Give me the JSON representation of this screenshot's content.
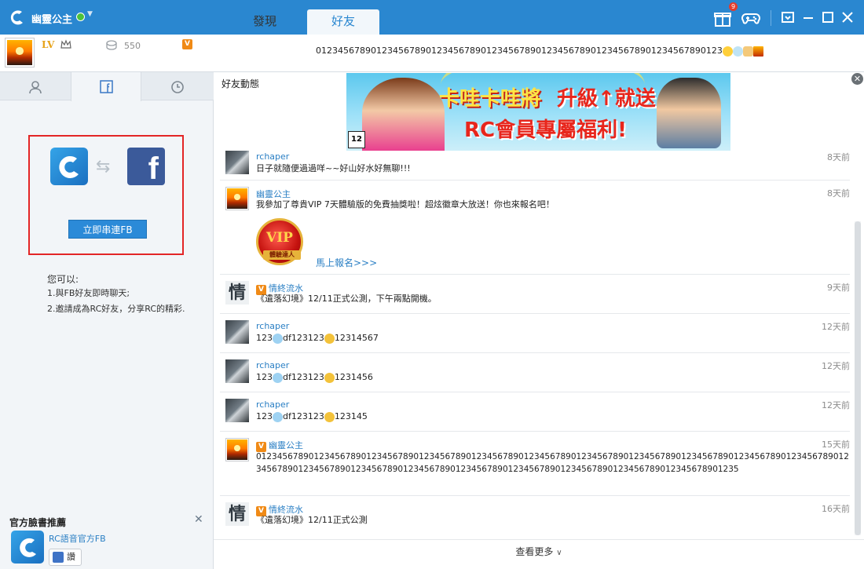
{
  "titlebar": {
    "username": "幽靈公主",
    "tabs": [
      {
        "label": "發現",
        "active": false
      },
      {
        "label": "好友",
        "active": true
      }
    ],
    "gift_badge": "9",
    "accent_color": "#2a87d0"
  },
  "profile": {
    "level_label": "LV",
    "coins": "550",
    "vip_mark": "V",
    "signature": "01234567890123456789012345678901234567890123456789012345678901234567890123"
  },
  "sidebar": {
    "fb_connect_button": "立即串連FB",
    "can_title": "您可以:",
    "can_items": [
      "1.與FB好友即時聊天;",
      "2.邀請成為RC好友，分享RC的精彩."
    ],
    "official_title": "官方臉書推薦",
    "official_name": "RC語音官方FB",
    "like_label": "讚"
  },
  "main": {
    "feed_title": "好友動態",
    "banner": {
      "age": "12",
      "line1a": "卡哇卡哇將",
      "line1b": "升級↑就送",
      "line2": "RC會員專屬福利!"
    },
    "posts": [
      {
        "name": "rchaper",
        "time": "8天前",
        "text": "日子就隨便過過咩~~好山好水好無聊!!!",
        "avatar": "dark",
        "vip": false
      },
      {
        "name": "幽靈公主",
        "time": "8天前",
        "text": "我參加了尊貴VIP 7天體驗版的免費抽獎啦！超炫徽章大放送！你也來報名吧！",
        "avatar": "sun",
        "vip": false,
        "vip_badge": "VIP",
        "vip_badge_sub": "體驗達人",
        "link": "馬上報名>>>"
      },
      {
        "name": "情終流水",
        "time": "9天前",
        "text": "《遺落幻境》12/11正式公測，下午兩點開機。",
        "avatar": "calli",
        "vip": true
      },
      {
        "name": "rchaper",
        "time": "12天前",
        "text_a": "123",
        "text_b": "df123123",
        "text_c": "12314567",
        "avatar": "dark",
        "vip": false
      },
      {
        "name": "rchaper",
        "time": "12天前",
        "text_a": "123",
        "text_b": "df123123",
        "text_c": "1231456",
        "avatar": "dark",
        "vip": false
      },
      {
        "name": "rchaper",
        "time": "12天前",
        "text_a": "123",
        "text_b": "df123123",
        "text_c": "123145",
        "avatar": "dark",
        "vip": false
      },
      {
        "name": "幽靈公主",
        "time": "15天前",
        "text": "0123456789012345678901234567890123456789012345678901234567890123456789012345678901234567890123456789012345678901234567890123456789012345678901234567890123456789012345678901234567890123456789012345678901235",
        "avatar": "sun",
        "vip": true
      },
      {
        "name": "情終流水",
        "time": "16天前",
        "text": "《遺落幻境》12/11正式公測",
        "avatar": "calli",
        "vip": true
      }
    ],
    "more_label": "查看更多"
  }
}
